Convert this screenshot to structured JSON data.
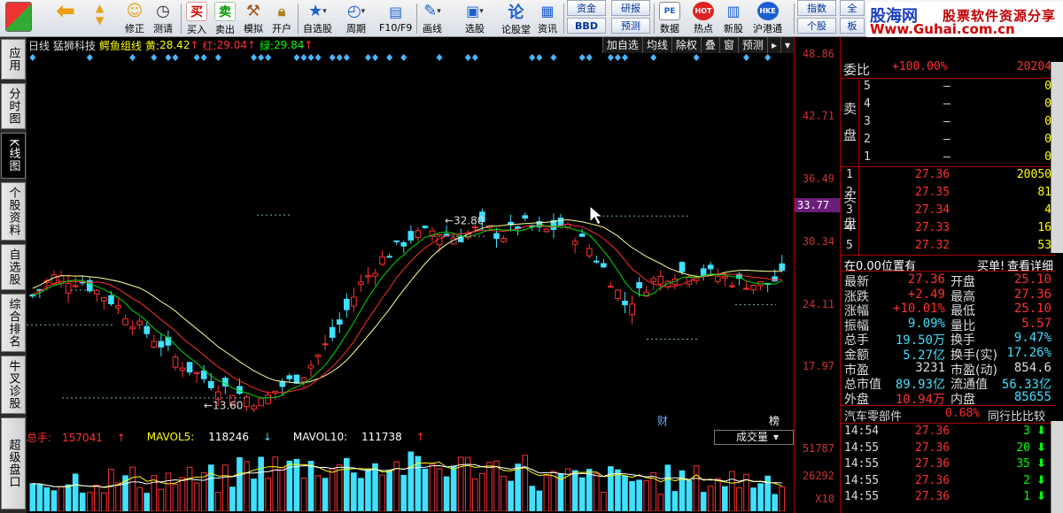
{
  "toolbar": {
    "buttons": [
      {
        "id": "revise",
        "label": "修正"
      },
      {
        "id": "test",
        "label": "测请"
      },
      {
        "id": "buy",
        "label": "买入",
        "icon_char": "买"
      },
      {
        "id": "sell",
        "label": "卖出",
        "icon_char": "卖"
      },
      {
        "id": "simulate",
        "label": "模拟"
      },
      {
        "id": "open",
        "label": "开户"
      },
      {
        "id": "watchlist",
        "label": "自选股"
      },
      {
        "id": "period",
        "label": "周期"
      },
      {
        "id": "f10",
        "label": "F10/F9"
      },
      {
        "id": "draw",
        "label": "画线"
      },
      {
        "id": "pick",
        "label": "选股"
      },
      {
        "id": "forum",
        "label": "论股堂",
        "icon_char": "论"
      },
      {
        "id": "info",
        "label": "资讯"
      },
      {
        "id": "data",
        "label": "数据",
        "icon_char": "PE"
      },
      {
        "id": "hot",
        "label": "热点",
        "icon_char": "HOT"
      },
      {
        "id": "ipo",
        "label": "新股"
      },
      {
        "id": "hk",
        "label": "沪港通",
        "icon_char": "HKE"
      }
    ],
    "small_buttons": {
      "capital": "资金",
      "bbd": "BBD",
      "research": "研报",
      "forecast": "预测",
      "index": "指数",
      "stock": "个股",
      "all": "全",
      "board": "板"
    },
    "brand": {
      "name": "股海网",
      "slogan": "股票软件资源分享",
      "url": "Www.Guhai.com.cn"
    }
  },
  "side_tabs": [
    "应用",
    "分时图",
    "K线图",
    "个股资料",
    "自选股",
    "综合排名",
    "牛叉诊股",
    "超级盘口"
  ],
  "active_tab": "K线图",
  "chart_header": {
    "period": "日线",
    "stock_name": "猛狮科技",
    "indicator": "鳄鱼组线",
    "yellow_label": "黄:",
    "yellow_value": "28.42",
    "red_label": "红:",
    "red_value": "29.04",
    "green_label": "绿:",
    "green_value": "29.84",
    "right_buttons": [
      "加自选",
      "均线",
      "除权",
      "叠",
      "窗",
      "预测"
    ]
  },
  "price_axis": {
    "ticks": [
      "48.86",
      "42.71",
      "36.49",
      "30.34",
      "24.11",
      "17.97"
    ],
    "current": "33.77"
  },
  "annotations": {
    "high": "32.80",
    "low": "13.60",
    "cai": "财",
    "bang": "榜"
  },
  "volume_header": {
    "total_label": "总手:",
    "total_value": "157041",
    "mavol5_label": "MAVOL5:",
    "mavol5_value": "118246",
    "mavol10_label": "MAVOL10:",
    "mavol10_value": "111738",
    "indicator_select": "成交量"
  },
  "volume_axis": {
    "ticks": [
      "51787",
      "26292"
    ],
    "multiplier": "X10"
  },
  "order_book": {
    "ratio_label": "委比",
    "ratio_value": "+100.00%",
    "ratio_diff": "20204",
    "sell_label": "卖盘",
    "sell": [
      {
        "level": "5",
        "price": "–",
        "qty": "0"
      },
      {
        "level": "4",
        "price": "–",
        "qty": "0"
      },
      {
        "level": "3",
        "price": "–",
        "qty": "0"
      },
      {
        "level": "2",
        "price": "–",
        "qty": "0"
      },
      {
        "level": "1",
        "price": "–",
        "qty": "0"
      }
    ],
    "buy_label": "买盘",
    "buy": [
      {
        "level": "1",
        "price": "27.36",
        "qty": "20050"
      },
      {
        "level": "2",
        "price": "27.35",
        "qty": "81"
      },
      {
        "level": "3",
        "price": "27.34",
        "qty": "4"
      },
      {
        "level": "4",
        "price": "27.33",
        "qty": "16"
      },
      {
        "level": "5",
        "price": "27.32",
        "qty": "53"
      }
    ]
  },
  "position_bar": {
    "text": "在0.00位置有",
    "buy_single": "买单!",
    "detail": "查看详细"
  },
  "quote": [
    {
      "l1": "最新",
      "v1": "27.36",
      "l2": "开盘",
      "v2": "25.10"
    },
    {
      "l1": "涨跌",
      "v1": "+2.49",
      "l2": "最高",
      "v2": "27.36"
    },
    {
      "l1": "涨幅",
      "v1": "+10.01%",
      "l2": "最低",
      "v2": "25.10"
    },
    {
      "l1": "振幅",
      "v1": "9.09%",
      "l2": "量比",
      "v2": "5.57"
    },
    {
      "l1": "总手",
      "v1": "19.50万",
      "l2": "换手",
      "v2": "9.47%"
    },
    {
      "l1": "金额",
      "v1": "5.27亿",
      "l2": "换手(实)",
      "v2": "17.26%"
    },
    {
      "l1": "市盈",
      "v1": "3231",
      "l2": "市盈(动)",
      "v2": "854.6"
    },
    {
      "l1": "总市值",
      "v1": "89.93亿",
      "l2": "流通值",
      "v2": "56.33亿"
    },
    {
      "l1": "外盘",
      "v1": "10.94万",
      "l2": "内盘",
      "v2": "85655"
    }
  ],
  "sector": {
    "name": "汽车零部件",
    "change": "0.68%",
    "compare": "同行比比较"
  },
  "ticks": [
    {
      "time": "14:54",
      "price": "27.36",
      "vol": "3"
    },
    {
      "time": "14:55",
      "price": "27.36",
      "vol": "20"
    },
    {
      "time": "14:55",
      "price": "27.36",
      "vol": "35"
    },
    {
      "time": "14:55",
      "price": "27.36",
      "vol": "2"
    },
    {
      "time": "14:55",
      "price": "27.36",
      "vol": "1"
    }
  ],
  "colors": {
    "up": "#ff3030",
    "down": "#40e0ff",
    "yellow": "#ffff00",
    "green": "#00ff00",
    "white": "#ffffff",
    "accent": "#6a1f7a"
  }
}
